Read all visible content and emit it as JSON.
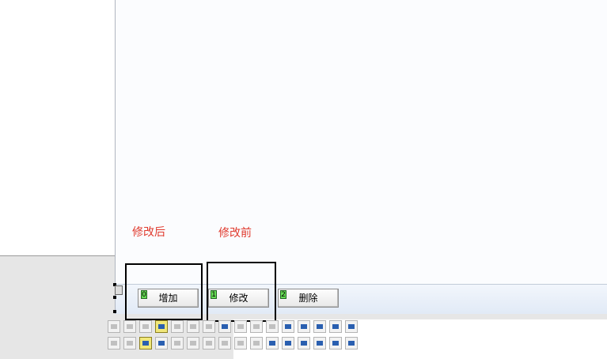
{
  "annotations": {
    "after": "修改后",
    "before": "修改前"
  },
  "buttons": [
    {
      "tab_index": "0",
      "label": "增加"
    },
    {
      "tab_index": "1",
      "label": "修改"
    },
    {
      "tab_index": "2",
      "label": "删除"
    }
  ],
  "toolbar": {
    "rows": [
      [
        "align-left-icon",
        "align-right-icon",
        "center-horizontal-icon",
        "align-top-icon",
        "align-bottom-icon",
        "center-vertical-icon",
        "same-width-icon",
        "space-horizontal-icon",
        "increase-horizontal-space-icon",
        "decrease-horizontal-space-icon",
        "remove-horizontal-space-icon",
        "bring-to-front-icon",
        "send-to-back-icon",
        "snap-to-grid-icon",
        "grid-icon",
        "size-to-grid-icon"
      ],
      [
        "align-bottom-edge-icon",
        "align-middle-icon",
        "center-vertical-form-icon",
        "make-same-height-icon",
        "make-same-size-icon",
        "space-vertical-icon",
        "increase-vertical-space-icon",
        "decrease-vertical-space-icon",
        "remove-vertical-space-icon",
        "size-to-fit-icon",
        "center-in-form-icon",
        "bring-forward-icon",
        "lock-controls-icon",
        "copy-format-icon",
        "tab-order-icon",
        "group-icon"
      ]
    ],
    "active": [
      "align-top-icon",
      "center-vertical-form-icon"
    ],
    "disabled": [
      "align-left-icon",
      "align-right-icon",
      "center-horizontal-icon",
      "align-bottom-icon",
      "center-vertical-icon",
      "same-width-icon",
      "align-bottom-edge-icon",
      "align-middle-icon",
      "make-same-size-icon",
      "space-vertical-icon",
      "increase-horizontal-space-icon",
      "decrease-horizontal-space-icon",
      "remove-horizontal-space-icon",
      "increase-vertical-space-icon",
      "decrease-vertical-space-icon",
      "remove-vertical-space-icon",
      "size-to-fit-icon"
    ]
  }
}
